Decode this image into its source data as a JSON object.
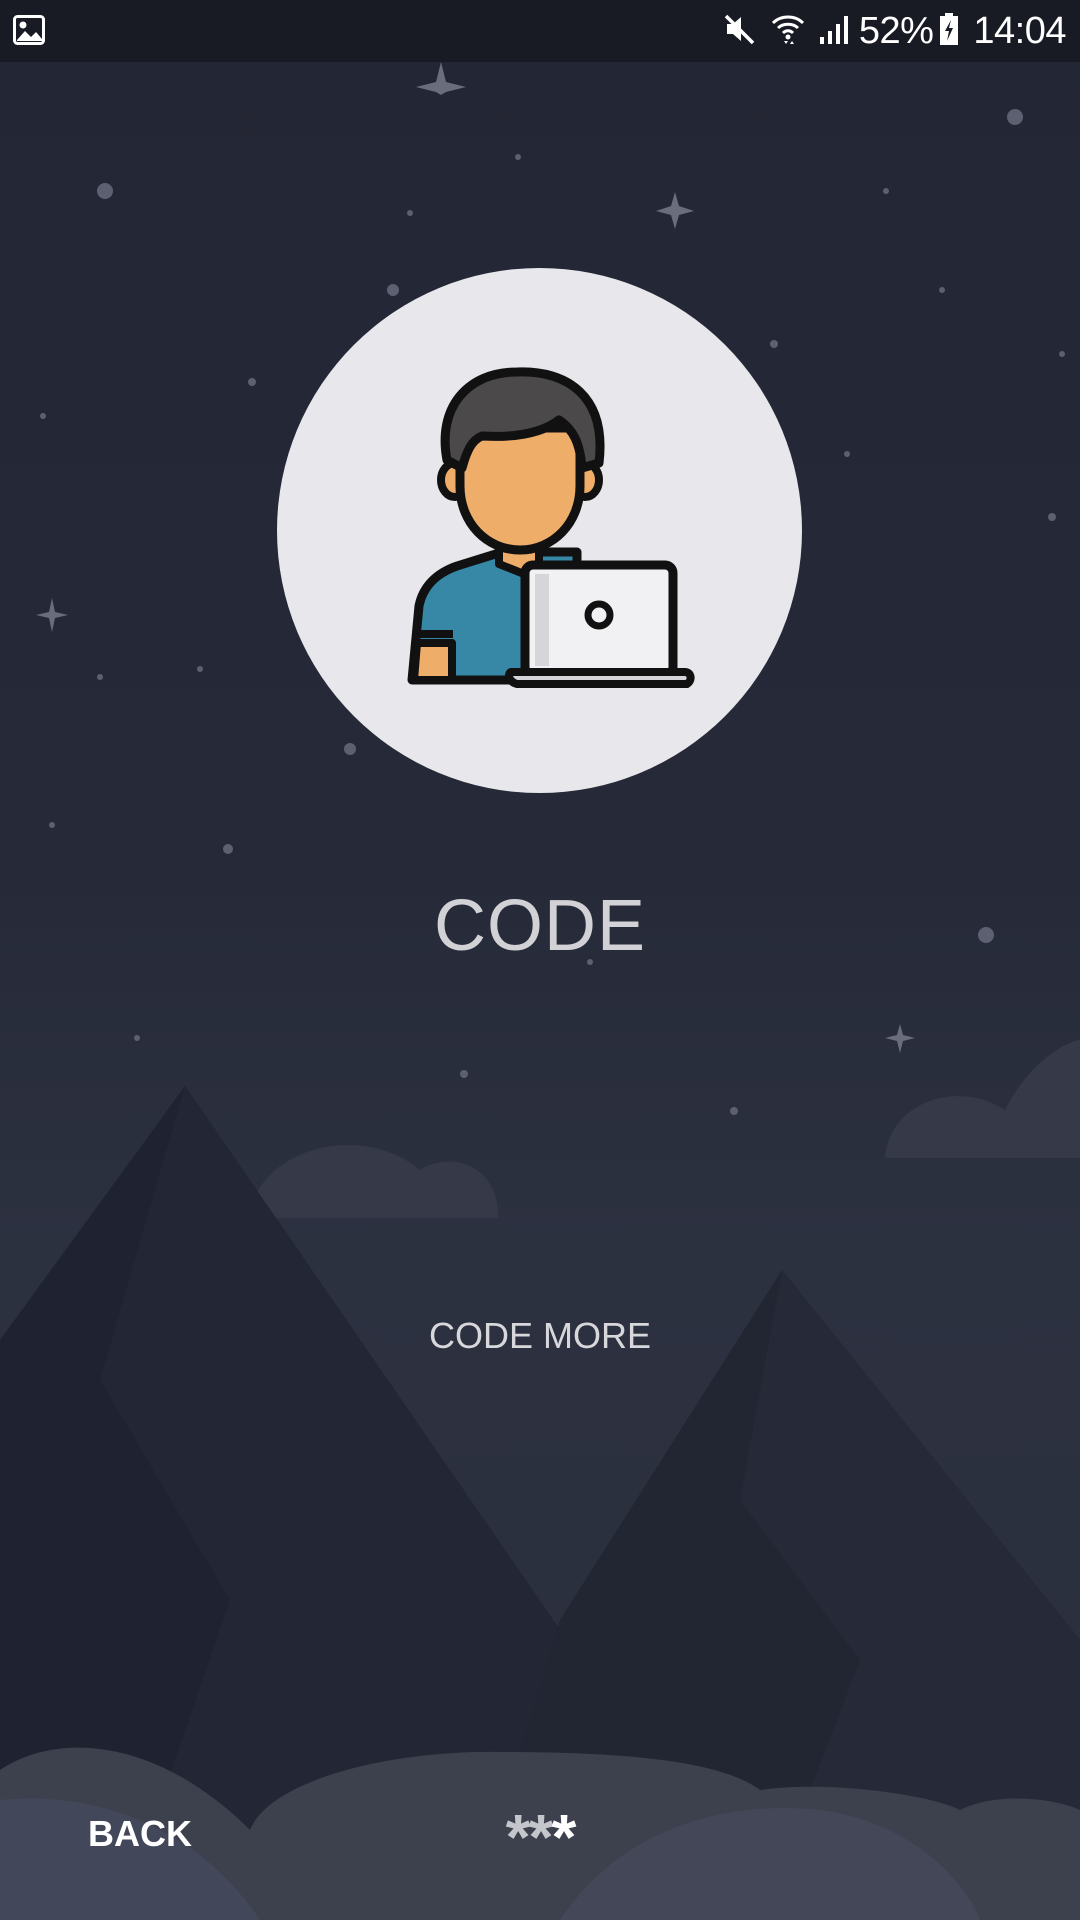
{
  "status_bar": {
    "left_icon": "gallery-notification-icon",
    "icons": [
      "mute-icon",
      "wifi-icon",
      "signal-icon"
    ],
    "battery_percent": "52%",
    "battery_icon": "battery-charging-icon",
    "time": "14:04"
  },
  "illustration": {
    "icon": "developer-laptop-avatar"
  },
  "slide": {
    "title": "CODE",
    "subtitle": "CODE MORE"
  },
  "navigation": {
    "back_label": "BACK",
    "indicator": [
      "*",
      "*",
      "*"
    ],
    "active_index": 2
  },
  "colors": {
    "background": "#232634",
    "status_bar": "#191b24",
    "avatar_circle": "#e8e8ec",
    "shirt": "#3688a6",
    "skin": "#efad6a",
    "hair": "#4b4949"
  }
}
